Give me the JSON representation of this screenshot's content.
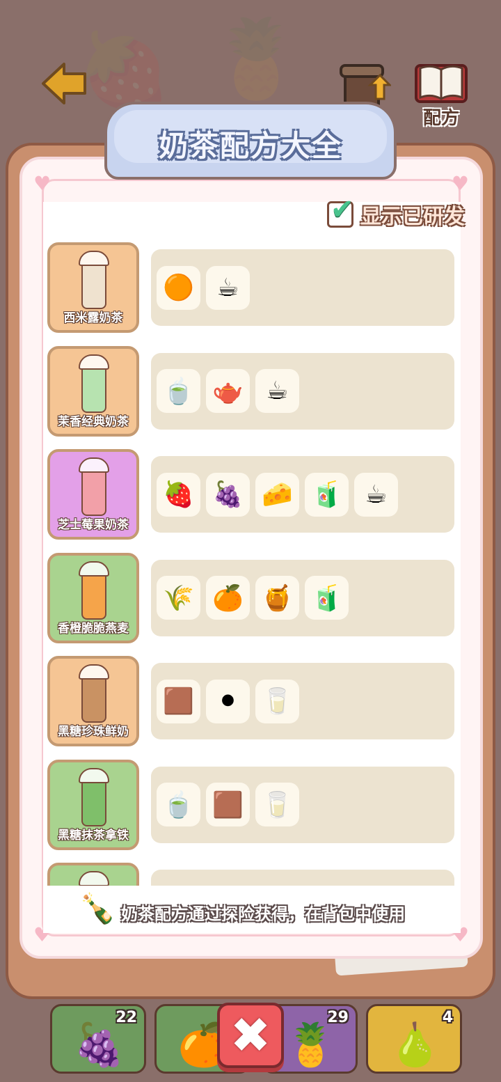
{
  "header": {
    "back_icon": "back-arrow-icon",
    "upgrade_label": "升级",
    "recipe_label": "配方"
  },
  "panel": {
    "title": "奶茶配方大全",
    "show_developed_label": "显示已研发",
    "show_developed_checked": true,
    "hint_text": "奶茶配方通过探险获得，在背包中使用"
  },
  "recipes": [
    {
      "name": "西米露奶茶",
      "card_color": "#f5c594",
      "cup_color": "#efe2cf",
      "ingredients": [
        "🟠",
        "☕"
      ]
    },
    {
      "name": "茉香经典奶茶",
      "card_color": "#f5c594",
      "cup_color": "#b7e3b0",
      "ingredients": [
        "🍵",
        "🫖",
        "☕"
      ]
    },
    {
      "name": "芝士莓果奶茶",
      "card_color": "#e3a0e8",
      "cup_color": "#f2a0a8",
      "ingredients": [
        "🍓",
        "🍇",
        "🧀",
        "🧃",
        "☕"
      ]
    },
    {
      "name": "香橙脆脆燕麦",
      "card_color": "#a9d38f",
      "cup_color": "#f5a44a",
      "ingredients": [
        "🌾",
        "🍊",
        "🍯",
        "🧃"
      ]
    },
    {
      "name": "黑糖珍珠鲜奶",
      "card_color": "#f5c594",
      "cup_color": "#c99263",
      "ingredients": [
        "🟫",
        "⚫",
        "🥛"
      ]
    },
    {
      "name": "黑糖抹茶拿铁",
      "card_color": "#a9d38f",
      "cup_color": "#7fbf6a",
      "ingredients": [
        "🍵",
        "🟫",
        "🥛"
      ]
    },
    {
      "name": "",
      "card_color": "#a9d38f",
      "cup_color": "#d8c7f0",
      "ingredients": []
    }
  ],
  "inventory": [
    {
      "icon": "🍇",
      "count": "22",
      "bg": "#6e9b5e"
    },
    {
      "icon": "🍊",
      "count": "",
      "bg": "#6e9b5e"
    },
    {
      "icon": "🍍",
      "count": "29",
      "bg": "#8e64a8"
    },
    {
      "icon": "🍐",
      "count": "4",
      "bg": "#e2b53e"
    }
  ],
  "close_icon": "close-icon"
}
